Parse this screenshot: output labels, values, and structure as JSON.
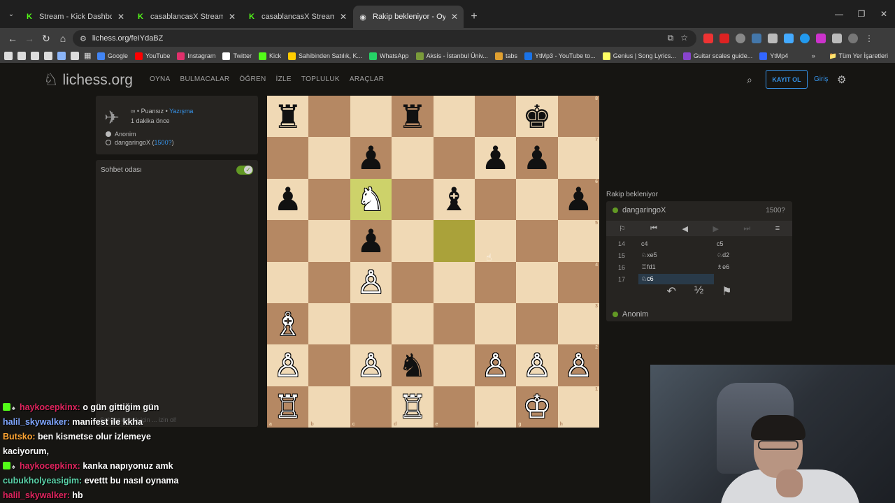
{
  "browser": {
    "tabs": [
      {
        "title": "Stream - Kick Dashboard",
        "icon": "kick-icon",
        "active": false
      },
      {
        "title": "casablancasX Stream - Watch L",
        "icon": "kick-icon",
        "active": false
      },
      {
        "title": "casablancasX Stream - Watch L",
        "icon": "kick-icon",
        "active": false
      },
      {
        "title": "Rakip bekleniyor - Oyna danga",
        "icon": "lichess-icon",
        "active": true
      }
    ],
    "url": "lichess.org/feIYdaBZ",
    "bookmarks": [
      "Google",
      "YouTube",
      "Instagram",
      "Twitter",
      "Kick",
      "Sahibinden Satılık, K...",
      "WhatsApp",
      "Aksis - İstanbul Üniv...",
      "tabs",
      "YtMp3 - YouTube to...",
      "Genius | Song Lyrics...",
      "Guitar scales guide...",
      "YtMp4"
    ],
    "bookmarks_all": "Tüm Yer İşaretleri",
    "bookmark_colors": [
      "#4285f4",
      "#ff0000",
      "#e1306c",
      "#ffffff",
      "#53fc18",
      "#ffcc00",
      "#25d366",
      "#7a9b3a",
      "#e0a030",
      "#1a73e8",
      "#ffff64",
      "#8844cc",
      "#3366ff"
    ]
  },
  "header": {
    "logo": "lichess.org",
    "nav": [
      "OYNA",
      "BULMACALAR",
      "ÖĞREN",
      "İZLE",
      "TOPLULUK",
      "ARAÇLAR"
    ],
    "signup": "KAYIT OL",
    "signin": "Giriş"
  },
  "game_meta": {
    "mode": "∞ • Puansız •",
    "mode_link": "Yazışma",
    "time_ago": "1 dakika önce",
    "players": [
      {
        "name": "Anonim",
        "rating": "",
        "color": "#bababa"
      },
      {
        "name": "dangaringoX",
        "rating": "1500?",
        "color": "#161512"
      }
    ]
  },
  "chat": {
    "title": "Sohbet odası",
    "placeholder": "Sohbet etmek için ... izin ol!"
  },
  "board": {
    "files": [
      "a",
      "b",
      "c",
      "d",
      "e",
      "f",
      "g",
      "h"
    ],
    "ranks": [
      "8",
      "7",
      "6",
      "5",
      "4",
      "3",
      "2",
      "1"
    ],
    "highlighted": [
      "c6",
      "e5"
    ],
    "pieces": {
      "a8": "♜b",
      "d8": "♜b",
      "g8": "♚b",
      "c7": "♟b",
      "f7": "♟b",
      "g7": "♟b",
      "a6": "♟b",
      "c6": "♞w",
      "e6": "♝b",
      "h6": "♟b",
      "c5": "♟b",
      "c4": "♙w",
      "a3": "♗w",
      "a2": "♙w",
      "c2": "♙w",
      "d2": "♞b",
      "f2": "♙w",
      "g2": "♙w",
      "h2": "♙w",
      "a1": "♖w",
      "d1": "♖w",
      "g1": "♔w"
    }
  },
  "right_panel": {
    "status": "Rakip bekleniyor",
    "opponent": {
      "name": "dangaringoX",
      "rating": "1500?"
    },
    "me": {
      "name": "Anonim"
    },
    "moves": [
      {
        "n": "14",
        "w": "c4",
        "b": "c5"
      },
      {
        "n": "15",
        "w": "♘xe5",
        "b": "♘d2"
      },
      {
        "n": "16",
        "w": "♖fd1",
        "b": "♗e6"
      },
      {
        "n": "17",
        "w": "♘c6",
        "b": ""
      }
    ]
  },
  "stream_chat": [
    {
      "user": "haykocepkinx:",
      "msg": "o gün gittiğim gün",
      "badge": true,
      "cls": "u1"
    },
    {
      "user": "halil_skywalker:",
      "msg": "manifest ile kkha",
      "badge": false,
      "cls": "u2"
    },
    {
      "user": "Butsko:",
      "msg": "ben kismetse olur izlemeye",
      "badge": false,
      "cls": "u3"
    },
    {
      "user": "",
      "msg": "kaciyorum,",
      "badge": false,
      "cls": "u3"
    },
    {
      "user": "haykocepkinx:",
      "msg": "kanka napıyonuz amk",
      "badge": true,
      "cls": "u1"
    },
    {
      "user": "cubukholyeasigim:",
      "msg": "evettt bu nasıl oynama",
      "badge": false,
      "cls": "u4"
    },
    {
      "user": "halil_skywalker:",
      "msg": "hb",
      "badge": false,
      "cls": "u1"
    }
  ]
}
